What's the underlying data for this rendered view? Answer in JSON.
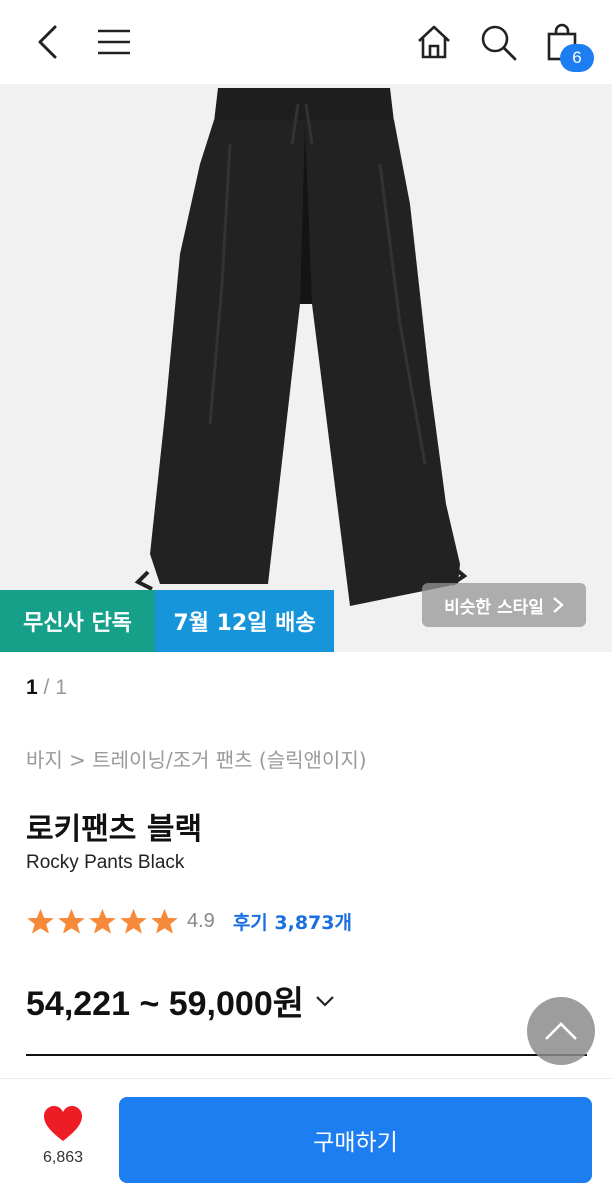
{
  "header": {
    "back_icon": "chevron-left-icon",
    "menu_icon": "hamburger-menu-icon",
    "home_icon": "home-icon",
    "search_icon": "search-icon",
    "cart_icon": "shopping-bag-icon",
    "cart_count": "6"
  },
  "hero": {
    "tag_exclusive": "무신사 단독",
    "tag_delivery": "7월 12일 배송",
    "similar_style": "비슷한 스타일",
    "pager_current": "1",
    "pager_total": "/ 1"
  },
  "product": {
    "breadcrumb": "바지 > 트레이닝/조거 팬츠 (슬릭앤이지)",
    "title_ko": "로키팬츠 블랙",
    "title_en": "Rocky Pants Black",
    "rating": 4.9,
    "rating_text": "4.9",
    "reviews": "후기 3,873개",
    "price": "54,221 ~ 59,000원"
  },
  "bottom": {
    "like_count": "6,863",
    "buy_label": "구매하기"
  },
  "colors": {
    "accent": "#1c7ef0",
    "green_tag": "#16a089",
    "blue_tag": "#1795db",
    "star": "#f7893a",
    "heart": "#ee1c24"
  }
}
